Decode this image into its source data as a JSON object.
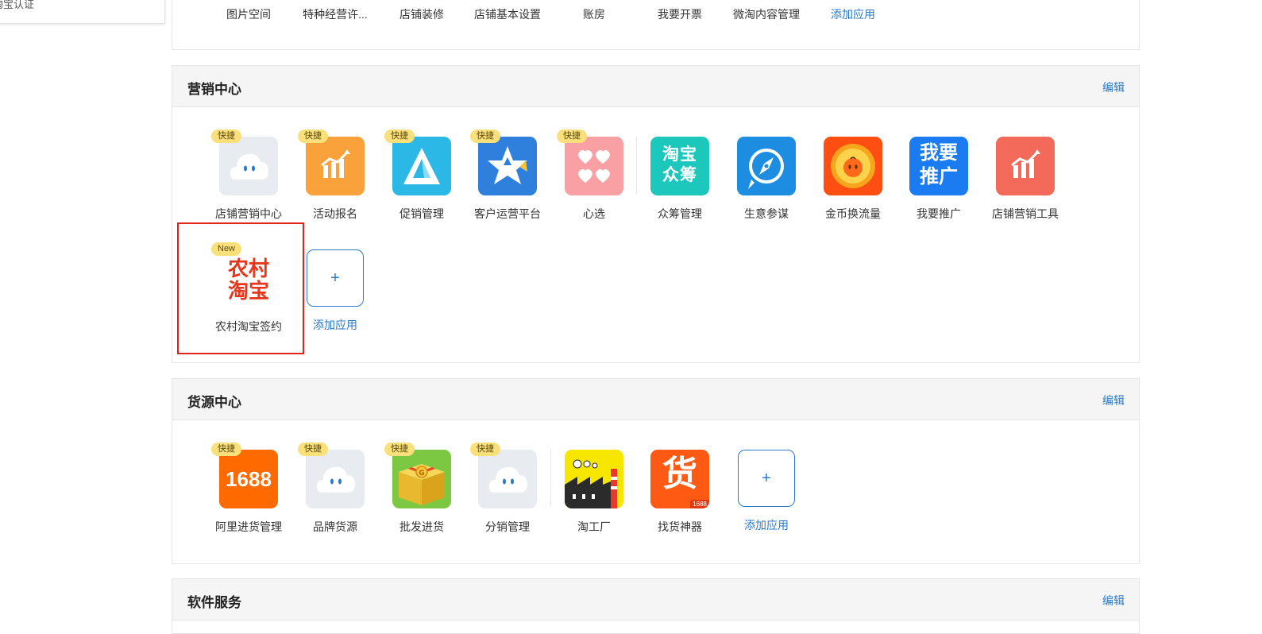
{
  "left_dropdown": {
    "item": "淘宝认证"
  },
  "top_section": {
    "apps": [
      "图片空间",
      "特种经营许...",
      "店铺装修",
      "店铺基本设置",
      "账房",
      "我要开票",
      "微淘内容管理"
    ],
    "add_label": "添加应用"
  },
  "marketing": {
    "title": "营销中心",
    "edit": "编辑",
    "apps": [
      {
        "label": "店铺营销中心",
        "badge": "快捷",
        "icon": "cloud-mascot-icon"
      },
      {
        "label": "活动报名",
        "badge": "快捷",
        "icon": "bar-chart-icon"
      },
      {
        "label": "促销管理",
        "badge": "快捷",
        "icon": "triangle-icon"
      },
      {
        "label": "客户运营平台",
        "badge": "快捷",
        "icon": "star-icon"
      },
      {
        "label": "心选",
        "badge": "快捷",
        "icon": "hearts-icon"
      },
      {
        "label": "众筹管理",
        "icon": "taobao-crowdfunding-icon",
        "icon_text_1": "淘宝",
        "icon_text_2": "众筹"
      },
      {
        "label": "生意参谋",
        "icon": "compass-icon"
      },
      {
        "label": "金币换流量",
        "icon": "gold-coin-icon"
      },
      {
        "label": "我要推广",
        "icon": "promote-icon",
        "icon_text_1": "我要",
        "icon_text_2": "推广"
      },
      {
        "label": "店铺营销工具",
        "icon": "bar-chart-icon"
      }
    ],
    "row2": {
      "label": "农村淘宝签约",
      "badge": "New",
      "icon": "rural-taobao-icon",
      "icon_text_1": "农村",
      "icon_text_2": "淘宝"
    },
    "add_label": "添加应用",
    "add_symbol": "+"
  },
  "supply": {
    "title": "货源中心",
    "edit": "编辑",
    "apps": [
      {
        "label": "阿里进货管理",
        "badge": "快捷",
        "icon": "1688-icon",
        "icon_text": "1688"
      },
      {
        "label": "品牌货源",
        "badge": "快捷",
        "icon": "cloud-mascot-icon"
      },
      {
        "label": "批发进货",
        "badge": "快捷",
        "icon": "gift-box-icon"
      },
      {
        "label": "分销管理",
        "badge": "快捷",
        "icon": "cloud-mascot-icon"
      },
      {
        "label": "淘工厂",
        "icon": "factory-icon"
      },
      {
        "label": "找货神器",
        "icon": "goods-finder-icon",
        "icon_text": "货",
        "icon_sub": "1688"
      }
    ],
    "add_label": "添加应用",
    "add_symbol": "+"
  },
  "software": {
    "title": "软件服务",
    "edit": "编辑"
  },
  "colors": {
    "link": "#2a7ac8",
    "badge": "#f9e07a",
    "highlight": "#e2231a"
  }
}
